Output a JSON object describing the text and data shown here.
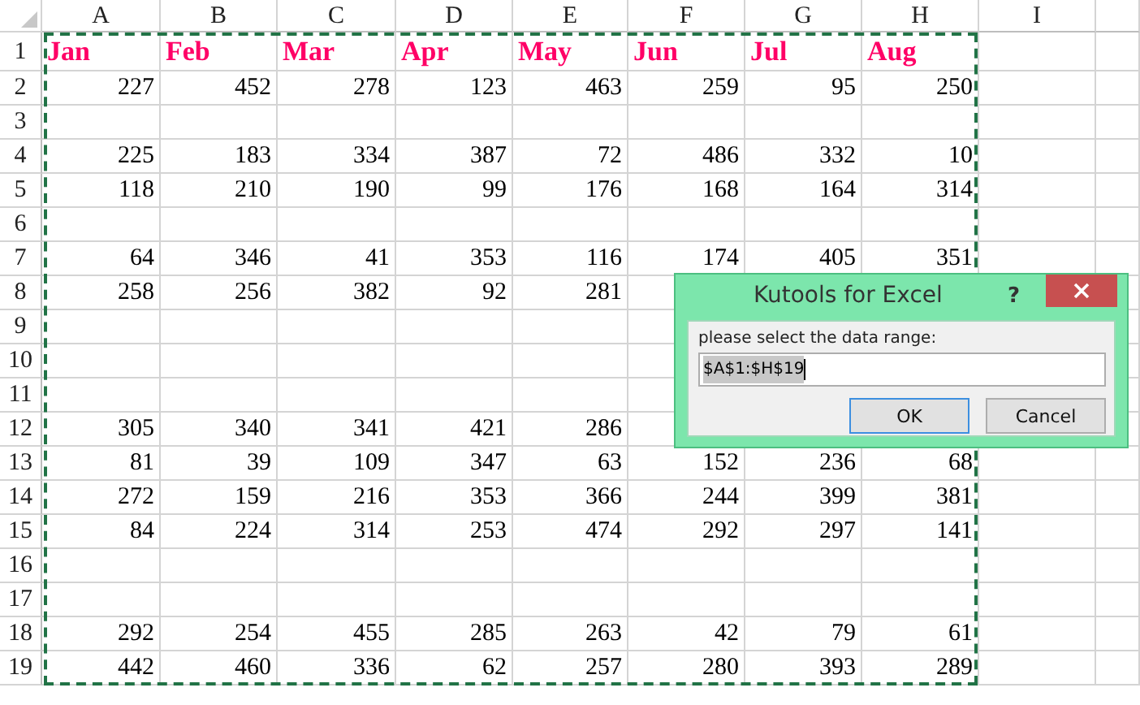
{
  "sheet": {
    "columns": [
      "A",
      "B",
      "C",
      "D",
      "E",
      "F",
      "G",
      "H",
      "I"
    ],
    "rows": [
      {
        "number": "1",
        "kind": "heading",
        "cells": [
          "Jan",
          "Feb",
          "Mar",
          "Apr",
          "May",
          "Jun",
          "Jul",
          "Aug"
        ]
      },
      {
        "number": "2",
        "kind": "values",
        "cells": [
          "227",
          "452",
          "278",
          "123",
          "463",
          "259",
          "95",
          "250"
        ]
      },
      {
        "number": "3",
        "cells": []
      },
      {
        "number": "4",
        "kind": "values",
        "cells": [
          "225",
          "183",
          "334",
          "387",
          "72",
          "486",
          "332",
          "10"
        ]
      },
      {
        "number": "5",
        "kind": "values",
        "cells": [
          "118",
          "210",
          "190",
          "99",
          "176",
          "168",
          "164",
          "314"
        ]
      },
      {
        "number": "6",
        "cells": []
      },
      {
        "number": "7",
        "kind": "values",
        "cells": [
          "64",
          "346",
          "41",
          "353",
          "116",
          "174",
          "405",
          "351"
        ]
      },
      {
        "number": "8",
        "kind": "values",
        "cells": [
          "258",
          "256",
          "382",
          "92",
          "281"
        ]
      },
      {
        "number": "9",
        "cells": []
      },
      {
        "number": "10",
        "cells": []
      },
      {
        "number": "11",
        "cells": []
      },
      {
        "number": "12",
        "kind": "values",
        "cells": [
          "305",
          "340",
          "341",
          "421",
          "286"
        ]
      },
      {
        "number": "13",
        "kind": "values",
        "cells": [
          "81",
          "39",
          "109",
          "347",
          "63",
          "152",
          "236",
          "68"
        ]
      },
      {
        "number": "14",
        "kind": "values",
        "cells": [
          "272",
          "159",
          "216",
          "353",
          "366",
          "244",
          "399",
          "381"
        ]
      },
      {
        "number": "15",
        "kind": "values",
        "cells": [
          "84",
          "224",
          "314",
          "253",
          "474",
          "292",
          "297",
          "141"
        ]
      },
      {
        "number": "16",
        "cells": []
      },
      {
        "number": "17",
        "cells": []
      },
      {
        "number": "18",
        "kind": "values",
        "cells": [
          "292",
          "254",
          "455",
          "285",
          "263",
          "42",
          "79",
          "61"
        ]
      },
      {
        "number": "19",
        "kind": "values",
        "cells": [
          "442",
          "460",
          "336",
          "62",
          "257",
          "280",
          "393",
          "289"
        ]
      }
    ]
  },
  "dialog": {
    "title": "Kutools for Excel",
    "help": "?",
    "label": "please select the data range:",
    "range_field": {
      "value": "$A$1:$H$19",
      "selected": true
    },
    "buttons": [
      {
        "label": "OK",
        "focused": true
      },
      {
        "label": "Cancel",
        "focused": false
      }
    ]
  }
}
